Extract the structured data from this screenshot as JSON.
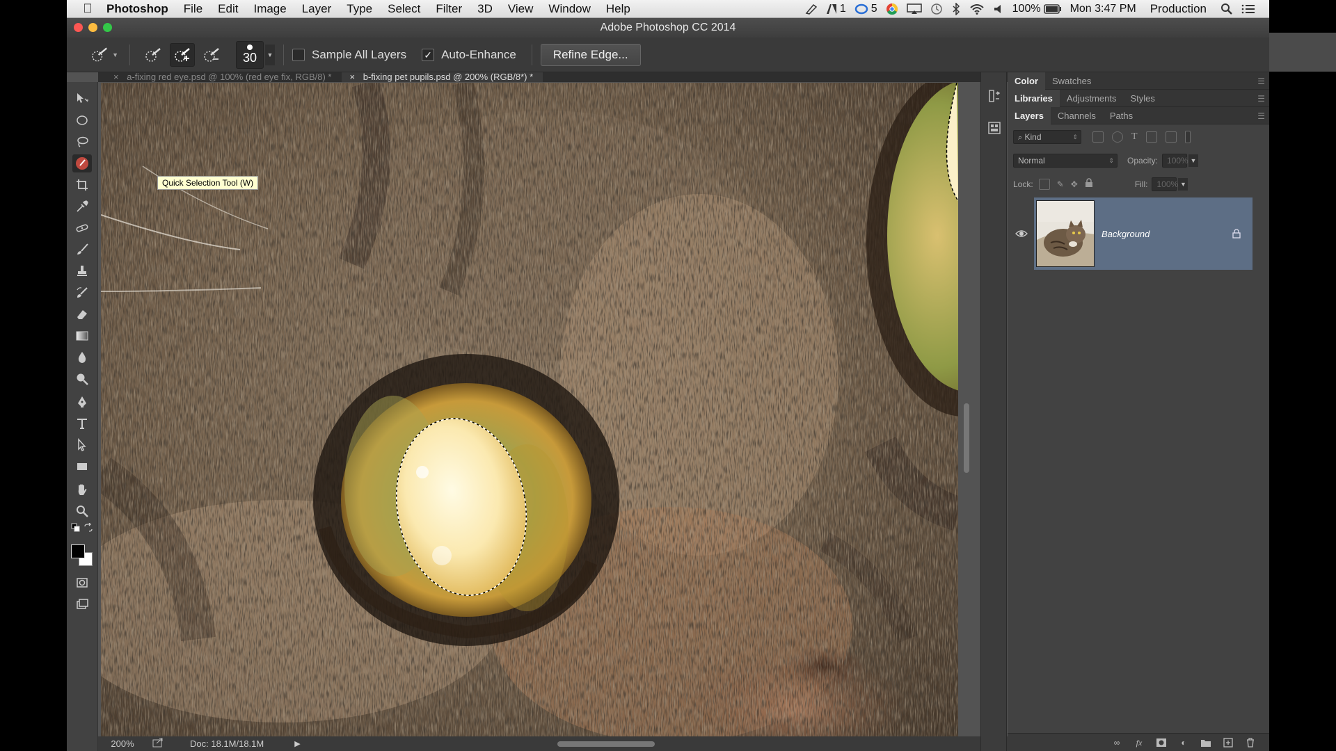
{
  "menubar": {
    "apple": "",
    "app_name": "Photoshop",
    "items": [
      "File",
      "Edit",
      "Image",
      "Layer",
      "Type",
      "Select",
      "Filter",
      "3D",
      "View",
      "Window",
      "Help"
    ],
    "status": {
      "adobe_count": "1",
      "cc_count": "5",
      "battery": "100%",
      "clock": "Mon 3:47 PM",
      "user": "Production"
    }
  },
  "window": {
    "title": "Adobe Photoshop CC 2014",
    "traffic_colors": [
      "#fc5753",
      "#fdbc40",
      "#33c748"
    ]
  },
  "options": {
    "brush_size": "30",
    "sample_all_layers_label": "Sample All Layers",
    "sample_all_layers_checked": false,
    "auto_enhance_label": "Auto-Enhance",
    "auto_enhance_checked": true,
    "auto_enhance_mark": "✓",
    "refine_edge_label": "Refine Edge..."
  },
  "tabs": [
    {
      "close": "×",
      "label": "a-fixing red eye.psd @ 100% (red eye fix, RGB/8) *"
    },
    {
      "close": "×",
      "label": "b-fixing pet pupils.psd @ 200% (RGB/8*) *"
    }
  ],
  "tooltip": "Quick Selection Tool (W)",
  "statusbar": {
    "zoom": "200%",
    "doc": "Doc: 18.1M/18.1M",
    "arrow": "▶"
  },
  "panels": {
    "group1": [
      "Color",
      "Swatches"
    ],
    "group2": [
      "Libraries",
      "Adjustments",
      "Styles"
    ],
    "group3": [
      "Layers",
      "Channels",
      "Paths"
    ],
    "kind_label": "Kind",
    "blend_mode": "Normal",
    "opacity_label": "Opacity:",
    "opacity_value": "100%",
    "lock_label": "Lock:",
    "fill_label": "Fill:",
    "fill_value": "100%",
    "layer_name": "Background",
    "footer_fx": "fx"
  },
  "colors": {
    "selected_layer": "#5d6e85",
    "app_bg": "#535353",
    "panel_bg": "#424242"
  }
}
